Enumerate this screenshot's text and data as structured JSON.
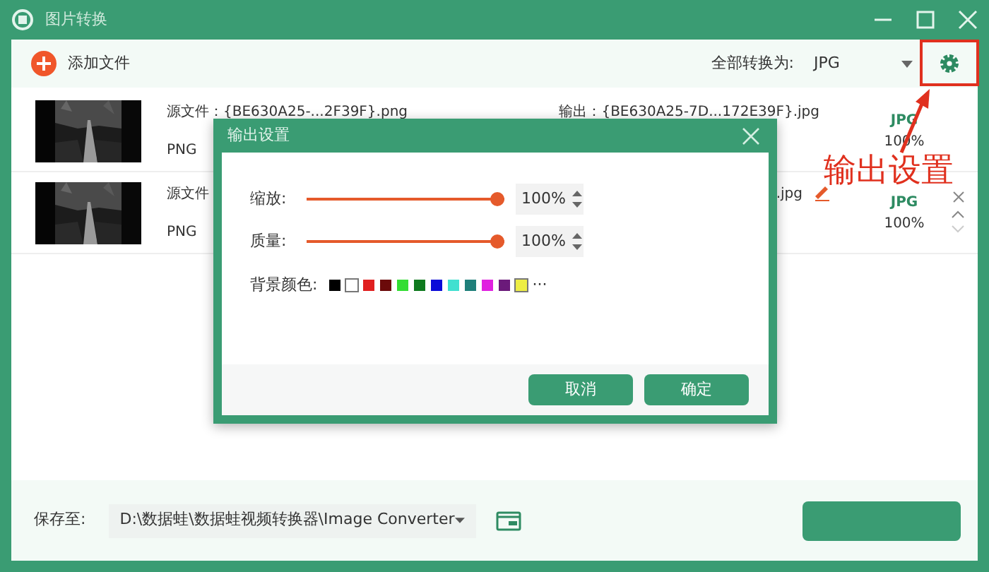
{
  "window": {
    "title": "图片转换"
  },
  "toolbar": {
    "add_label": "添加文件",
    "convert_all_label": "全部转换为:",
    "format": "JPG"
  },
  "files": [
    {
      "source": "源文件：{BE630A25-...2F39F}.png",
      "source_format": "PNG",
      "output": "输出：{BE630A25-7D...172E39F}.jpg",
      "target_format": "JPG",
      "quality": "100%",
      "reorder_controls": false
    },
    {
      "source": "源文件",
      "source_format": "PNG",
      "output": ".jpg",
      "target_format": "JPG",
      "quality": "100%",
      "reorder_controls": true
    }
  ],
  "dialog": {
    "title": "输出设置",
    "sliders": [
      {
        "label": "缩放:",
        "level": 1,
        "reading": "100%"
      },
      {
        "label": "质量:",
        "level": 1,
        "reading": "100%"
      }
    ],
    "background_label": "背景颜色:",
    "swatches": [
      {
        "color": "#000000"
      },
      {
        "color": "#ffffff"
      },
      {
        "color": "#e02020"
      },
      {
        "color": "#6b0a0a"
      },
      {
        "color": "#33dd33"
      },
      {
        "color": "#0f7a1f"
      },
      {
        "color": "#0a0ad8"
      },
      {
        "color": "#40e0d0"
      },
      {
        "color": "#1f7f7a"
      },
      {
        "color": "#e020e0"
      },
      {
        "color": "#6b1a7a"
      },
      {
        "color": "#eeee44"
      }
    ],
    "more": "···",
    "buttons": [
      "取消",
      "确定"
    ]
  },
  "save": {
    "label": "保存至:",
    "path": "D:\\数据蛙\\数据蛙视频转换器\\Image Converter"
  },
  "annotation": {
    "text": "输出设置"
  }
}
